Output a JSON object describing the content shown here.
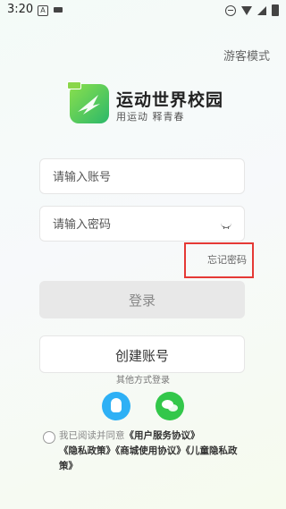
{
  "status_bar": {
    "time": "3:20",
    "a_icon_letter": "A"
  },
  "guest_mode": "游客模式",
  "app": {
    "name": "运动世界校园",
    "slogan": "用运动 释青春"
  },
  "account_input": {
    "placeholder": "请输入账号",
    "value": ""
  },
  "password_input": {
    "placeholder": "请输入密码",
    "value": ""
  },
  "forgot_password": "忘记密码",
  "login_button": "登录",
  "create_account_button": "创建账号",
  "other_login_label": "其他方式登录",
  "agreement": {
    "prefix": "我已阅读并同意",
    "user_service": "《用户服务协议》",
    "privacy": "《隐私政策》",
    "mall": "《商城使用协议》",
    "children_privacy": "《儿童隐私政策》"
  },
  "colors": {
    "qq": "#2eb0f5",
    "wechat": "#33c74a",
    "highlight_border": "#e53935"
  }
}
